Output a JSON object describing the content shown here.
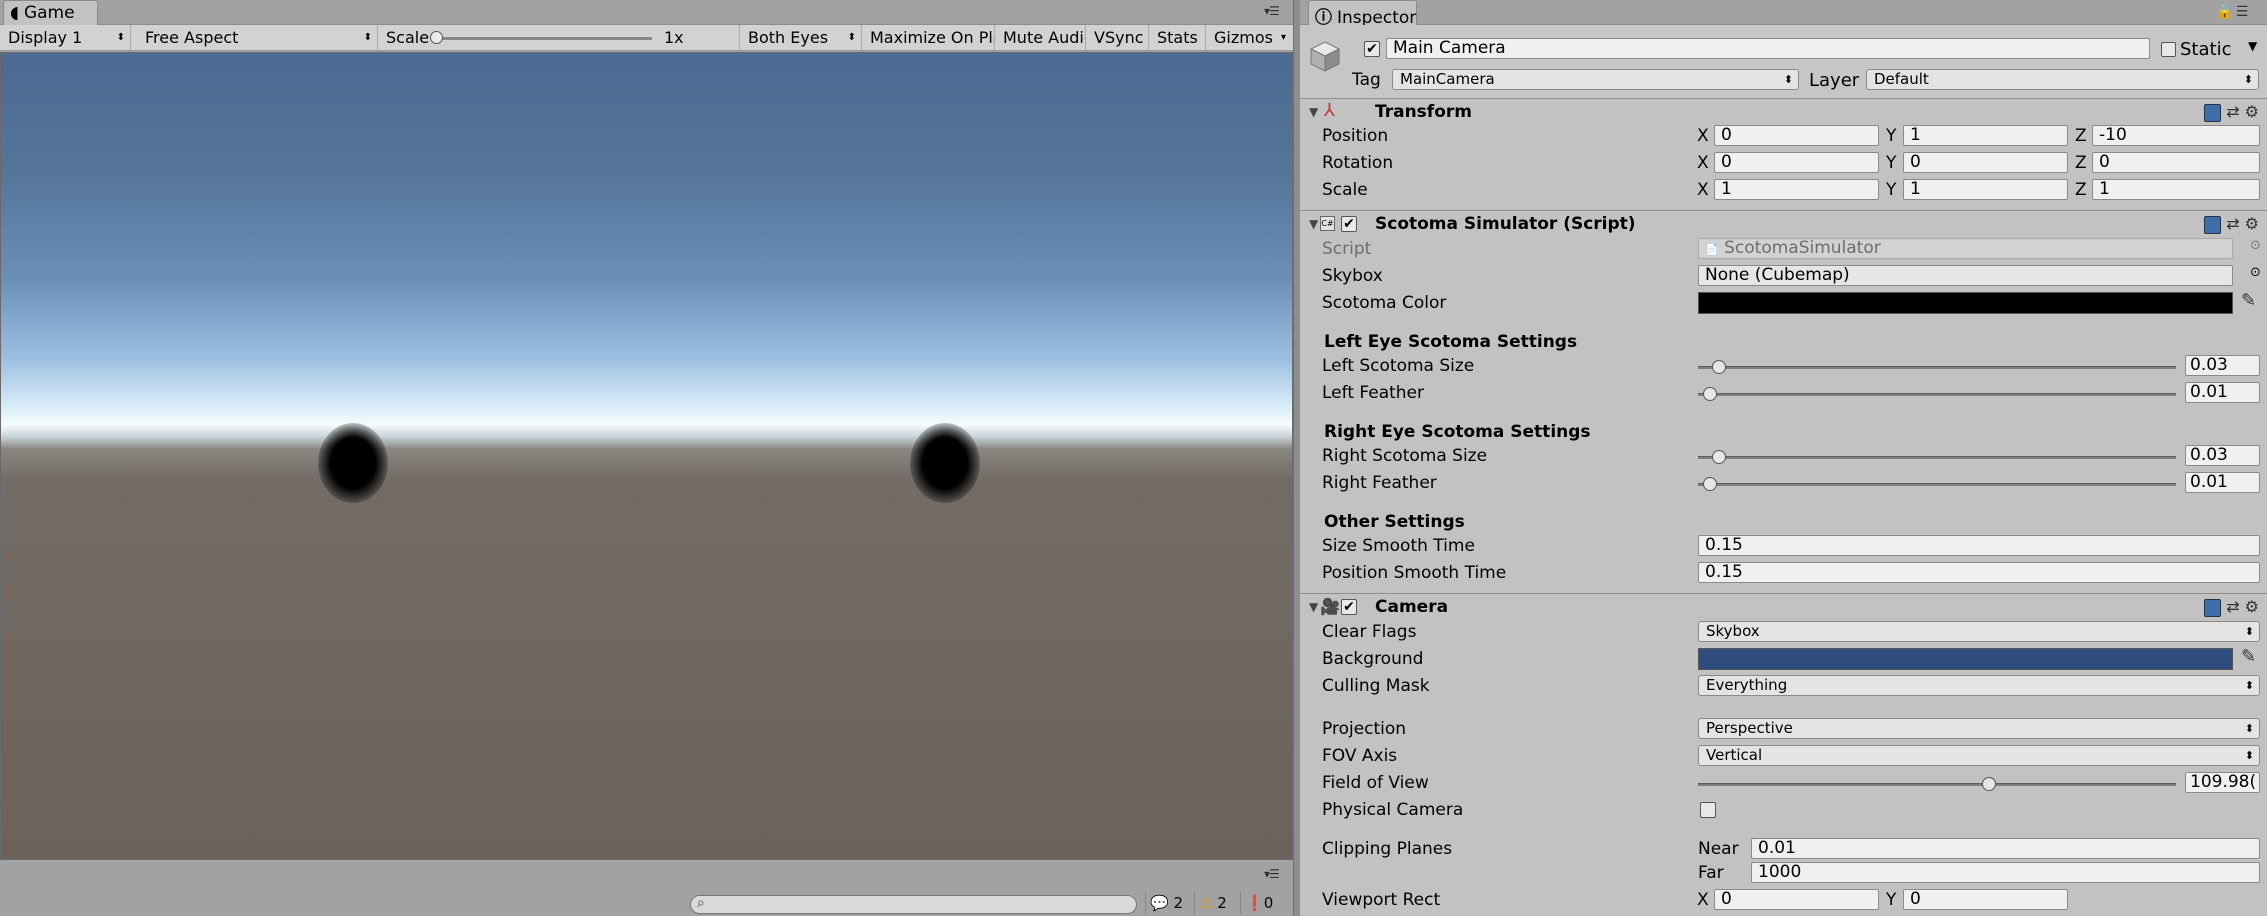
{
  "game_tab": {
    "label": "Game",
    "icon": "game-controller-icon"
  },
  "game_toolbar": {
    "display": "Display 1",
    "aspect": "Free Aspect",
    "scale_label": "Scale",
    "scale_value": "1x",
    "stereo": "Both Eyes",
    "maximize": "Maximize On Play",
    "mute": "Mute Audio",
    "vsync": "VSync",
    "stats": "Stats",
    "gizmos": "Gizmos"
  },
  "console": {
    "info_count": "2",
    "warn_count": "2",
    "error_count": "0"
  },
  "inspector_tab": {
    "label": "Inspector",
    "icon": "info-icon"
  },
  "gameobject": {
    "name": "Main Camera",
    "active": true,
    "static_label": "Static",
    "tag_label": "Tag",
    "tag_value": "MainCamera",
    "layer_label": "Layer",
    "layer_value": "Default"
  },
  "transform": {
    "title": "Transform",
    "position": {
      "label": "Position",
      "x": "0",
      "y": "1",
      "z": "-10"
    },
    "rotation": {
      "label": "Rotation",
      "x": "0",
      "y": "0",
      "z": "0"
    },
    "scale": {
      "label": "Scale",
      "x": "1",
      "y": "1",
      "z": "1"
    },
    "axis": {
      "x": "X",
      "y": "Y",
      "z": "Z"
    }
  },
  "scotoma": {
    "title": "Scotoma Simulator (Script)",
    "script_label": "Script",
    "script_value": "ScotomaSimulator",
    "skybox_label": "Skybox",
    "skybox_value": "None (Cubemap)",
    "color_label": "Scotoma Color",
    "color_value": "#000000",
    "left_header": "Left Eye Scotoma Settings",
    "left_size_label": "Left Scotoma Size",
    "left_size_value": "0.03",
    "left_size_fraction": 0.03,
    "left_feather_label": "Left Feather",
    "left_feather_value": "0.01",
    "left_feather_fraction": 0.01,
    "right_header": "Right Eye Scotoma Settings",
    "right_size_label": "Right Scotoma Size",
    "right_size_value": "0.03",
    "right_size_fraction": 0.03,
    "right_feather_label": "Right Feather",
    "right_feather_value": "0.01",
    "right_feather_fraction": 0.01,
    "other_header": "Other Settings",
    "size_smooth_label": "Size Smooth Time",
    "size_smooth_value": "0.15",
    "pos_smooth_label": "Position Smooth Time",
    "pos_smooth_value": "0.15"
  },
  "camera": {
    "title": "Camera",
    "clear_flags_label": "Clear Flags",
    "clear_flags_value": "Skybox",
    "background_label": "Background",
    "background_color": "#2f4c7e",
    "culling_label": "Culling Mask",
    "culling_value": "Everything",
    "projection_label": "Projection",
    "projection_value": "Perspective",
    "fov_axis_label": "FOV Axis",
    "fov_axis_value": "Vertical",
    "fov_label": "Field of View",
    "fov_value": "109.98(",
    "fov_fraction": 0.61,
    "physical_label": "Physical Camera",
    "clipping_label": "Clipping Planes",
    "near_label": "Near",
    "near_value": "0.01",
    "far_label": "Far",
    "far_value": "1000",
    "viewport_label": "Viewport Rect",
    "viewport_x": "0",
    "viewport_y": "0"
  }
}
